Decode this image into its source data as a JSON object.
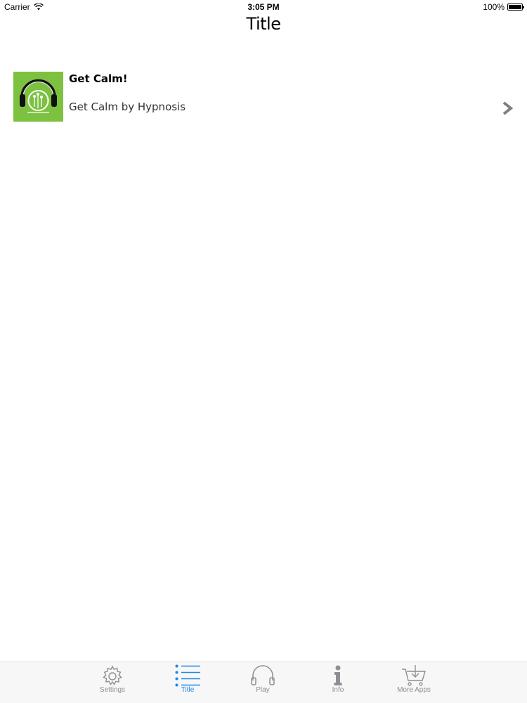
{
  "status_bar": {
    "carrier": "Carrier",
    "time": "3:05 PM",
    "battery": "100%"
  },
  "nav": {
    "title": "Title"
  },
  "list": {
    "items": [
      {
        "title": "Get Calm!",
        "subtitle": "Get Calm by Hypnosis"
      }
    ]
  },
  "tabs": [
    {
      "label": "Settings",
      "icon": "gear-icon",
      "active": false
    },
    {
      "label": "Title",
      "icon": "list-icon",
      "active": true
    },
    {
      "label": "Play",
      "icon": "headphones-icon",
      "active": false
    },
    {
      "label": "Info",
      "icon": "info-icon",
      "active": false
    },
    {
      "label": "More Apps",
      "icon": "cart-icon",
      "active": false
    }
  ],
  "colors": {
    "accent": "#1e88e5",
    "inactive": "#8e8e93",
    "artwork_green": "#7dc141"
  }
}
